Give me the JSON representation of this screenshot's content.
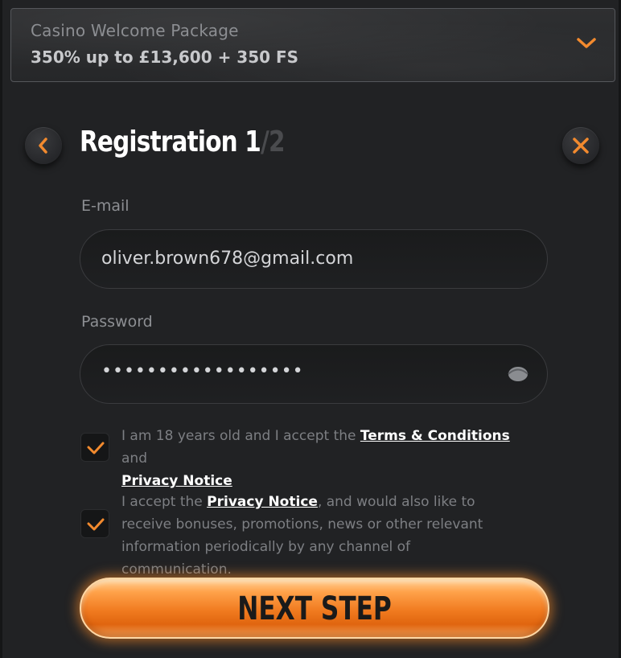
{
  "promo": {
    "title": "Casino Welcome Package",
    "value": "350% up to £13,600 + 350 FS",
    "icon": "chevron-down-icon"
  },
  "header": {
    "title": "Registration 1",
    "step_total": "/2",
    "back_icon": "chevron-left-icon",
    "close_icon": "close-icon"
  },
  "form": {
    "email_label": "E-mail",
    "email_value": "oliver.brown678@gmail.com",
    "password_label": "Password",
    "password_value": "••••••••••••••••••",
    "password_toggle_icon": "eye-icon"
  },
  "consents": [
    {
      "checked": true,
      "text_before": "I am 18 years old and I accept the ",
      "link1": "Terms & Conditions",
      "text_middle": " and ",
      "link2": "Privacy Notice"
    },
    {
      "checked": true,
      "text_before": "I accept the ",
      "link1": "Privacy Notice",
      "text_after": ", and would also like to receive bonuses, promotions, news or other relevant information periodically by any channel of communication."
    }
  ],
  "next_button": {
    "label": "NEXT STEP"
  },
  "colors": {
    "accent": "#f28a2e",
    "background": "#212224",
    "field": "#1c1d1f",
    "muted_text": "#8d8f93"
  }
}
